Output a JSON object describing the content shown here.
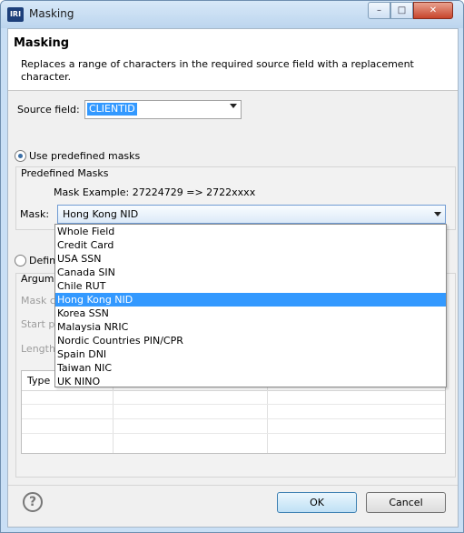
{
  "window": {
    "title": "Masking",
    "icon": "IRI",
    "controls": [
      "minimize-icon",
      "maximize-icon",
      "close-icon"
    ]
  },
  "header": {
    "title": "Masking",
    "description": "Replaces a range of characters in the required source field with a replacement character."
  },
  "source_field": {
    "label": "Source field:",
    "value": "CLIENTID"
  },
  "options": {
    "predefined_label": "Use predefined masks",
    "define_label": "Defin",
    "selected": "predefined"
  },
  "predefined": {
    "group_title": "Predefined Masks",
    "example": "Mask Example: 27224729 => 2722xxxx",
    "mask_label": "Mask:",
    "selected_mask": "Hong Kong NID",
    "items": [
      "Whole Field",
      "Credit Card",
      "USA SSN",
      "Canada SIN",
      "Chile RUT",
      "Hong Kong NID",
      "Korea SSN",
      "Malaysia NRIC",
      "Nordic Countries PIN/CPR",
      "Spain DNI",
      "Taiwan NIC",
      "UK NINO"
    ]
  },
  "custom_section": {
    "arguments_label": "Argum",
    "mask_label": "Mask c",
    "start_label": "Start p",
    "length_label": "Length"
  },
  "table": {
    "columns": [
      "Type"
    ]
  },
  "footer": {
    "help_icon": "question-mark-icon",
    "ok_label": "OK",
    "cancel_label": "Cancel"
  }
}
